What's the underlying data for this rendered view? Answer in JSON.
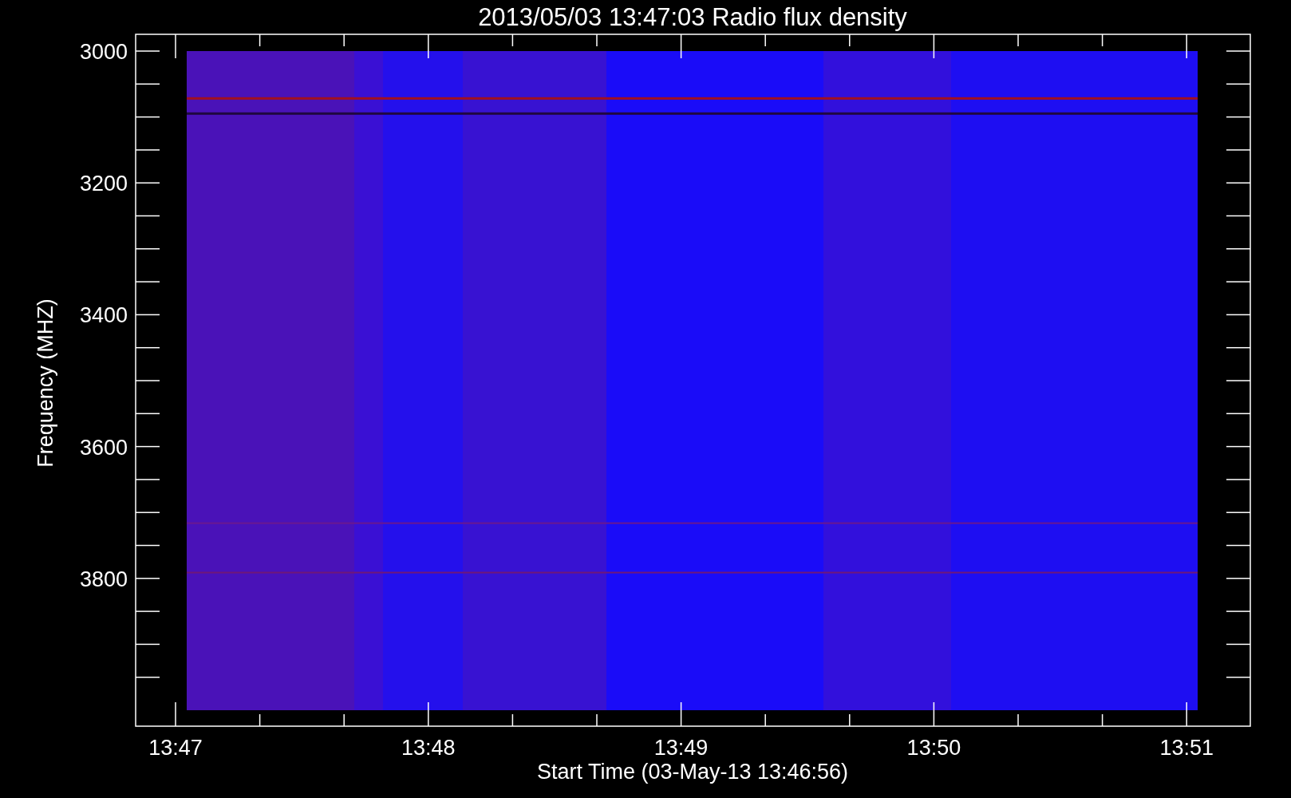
{
  "title": "2013/05/03 13:47:03 Radio flux density",
  "y_axis": {
    "label": "Frequency (MHZ)",
    "ticks": [
      "3000",
      "3200",
      "3400",
      "3600",
      "3800"
    ]
  },
  "x_axis": {
    "label": "Start Time (03-May-13 13:46:56)",
    "ticks": [
      "13:47",
      "13:48",
      "13:49",
      "13:50",
      "13:51"
    ]
  }
}
